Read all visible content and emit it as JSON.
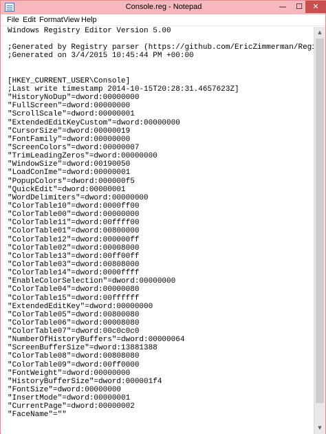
{
  "window": {
    "title": "Console.reg - Notepad",
    "minimize_glyph": "—",
    "maximize_glyph": "☐",
    "close_glyph": "✕"
  },
  "menu": [
    "File",
    "Edit",
    "Format",
    "View",
    "Help"
  ],
  "scrollbar": {
    "up_glyph": "▲",
    "down_glyph": "▼",
    "thumb_fraction": 0.95
  },
  "content": {
    "lines": [
      "Windows Registry Editor Version 5.00",
      "",
      ";Generated by Registry parser (https://github.com/EricZimmerman/Registry)",
      ";Generated on 3/4/2015 10:45:44 PM +00:00",
      "",
      "",
      "[HKEY_CURRENT_USER\\Console]",
      ";Last write timestamp 2014-10-15T20:28:31.4657623Z]",
      "\"HistoryNoDup\"=dword:00000000",
      "\"FullScreen\"=dword:00000000",
      "\"ScrollScale\"=dword:00000001",
      "\"ExtendedEditKeyCustom\"=dword:00000000",
      "\"CursorSize\"=dword:00000019",
      "\"FontFamily\"=dword:00000000",
      "\"ScreenColors\"=dword:00000007",
      "\"TrimLeadingZeros\"=dword:00000000",
      "\"WindowSize\"=dword:00190050",
      "\"LoadConIme\"=dword:00000001",
      "\"PopupColors\"=dword:000000f5",
      "\"QuickEdit\"=dword:00000001",
      "\"WordDelimiters\"=dword:00000000",
      "\"ColorTable10\"=dword:0000ff00",
      "\"ColorTable00\"=dword:00000000",
      "\"ColorTable11\"=dword:00ffff00",
      "\"ColorTable01\"=dword:00800000",
      "\"ColorTable12\"=dword:000000ff",
      "\"ColorTable02\"=dword:00008000",
      "\"ColorTable13\"=dword:00ff00ff",
      "\"ColorTable03\"=dword:00808000",
      "\"ColorTable14\"=dword:0000ffff",
      "\"EnableColorSelection\"=dword:00000000",
      "\"ColorTable04\"=dword:00000080",
      "\"ColorTable15\"=dword:00ffffff",
      "\"ExtendedEditKey\"=dword:00000000",
      "\"ColorTable05\"=dword:00800080",
      "\"ColorTable06\"=dword:00008080",
      "\"ColorTable07\"=dword:00c0c0c0",
      "\"NumberOfHistoryBuffers\"=dword:00000064",
      "\"ScreenBufferSize\"=dword:13881388",
      "\"ColorTable08\"=dword:00808080",
      "\"ColorTable09\"=dword:00ff0000",
      "\"FontWeight\"=dword:00000000",
      "\"HistoryBufferSize\"=dword:000001f4",
      "\"FontSize\"=dword:00000000",
      "\"InsertMode\"=dword:00000001",
      "\"CurrentPage\"=dword:00000002",
      "\"FaceName\"=\"\""
    ]
  }
}
